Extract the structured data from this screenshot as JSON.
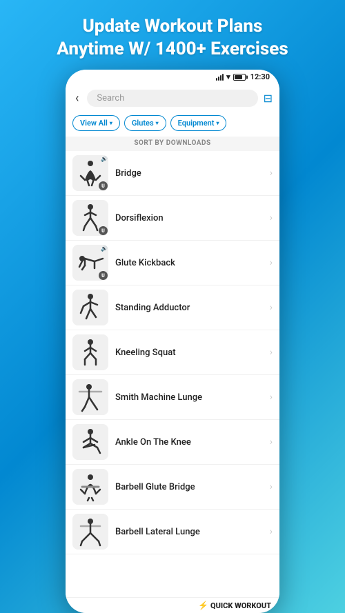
{
  "headline": {
    "line1": "Update Workout Plans",
    "line2": "Anytime W/ 1400+ Exercises"
  },
  "status_bar": {
    "time": "12:30"
  },
  "search": {
    "placeholder": "Search"
  },
  "filters": [
    {
      "label": "View All",
      "id": "view-all"
    },
    {
      "label": "Glutes",
      "id": "glutes"
    },
    {
      "label": "Equipment",
      "id": "equipment"
    }
  ],
  "sort_label": "SORT BY DOWNLOADS",
  "exercises": [
    {
      "name": "Bridge",
      "has_sound": true,
      "has_u_badge": true
    },
    {
      "name": "Dorsiflexion",
      "has_sound": false,
      "has_u_badge": true
    },
    {
      "name": "Glute Kickback",
      "has_sound": true,
      "has_u_badge": true
    },
    {
      "name": "Standing Adductor",
      "has_sound": false,
      "has_u_badge": false
    },
    {
      "name": "Kneeling Squat",
      "has_sound": false,
      "has_u_badge": false
    },
    {
      "name": "Smith Machine Lunge",
      "has_sound": false,
      "has_u_badge": false
    },
    {
      "name": "Ankle On The Knee",
      "has_sound": false,
      "has_u_badge": false
    },
    {
      "name": "Barbell Glute Bridge",
      "has_sound": false,
      "has_u_badge": false
    },
    {
      "name": "Barbell Lateral Lunge",
      "has_sound": false,
      "has_u_badge": false
    }
  ],
  "quick_workout": {
    "label": "QUICK WORKOUT",
    "icon": "⚡"
  },
  "back_icon": "‹",
  "filter_icon": "⊟",
  "chevron_right": "›"
}
